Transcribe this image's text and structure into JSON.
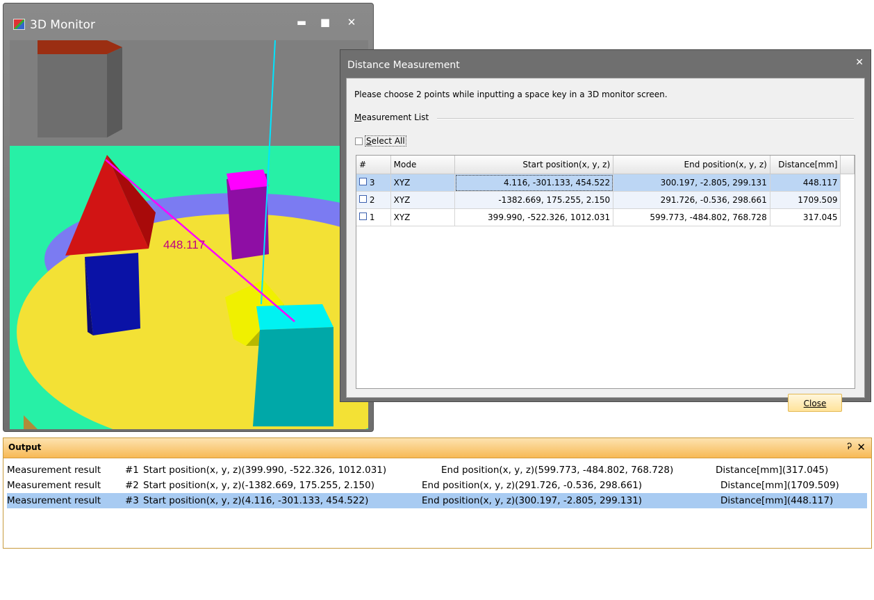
{
  "monitor_window": {
    "title": "3D Monitor",
    "overlay_distance_label": "448.117",
    "controls": {
      "minimize": "▬",
      "maximize": "■",
      "close": "✕"
    }
  },
  "dialog": {
    "title": "Distance Measurement",
    "close_glyph": "✕",
    "instruction": "Please choose 2 points while inputting a space key in a 3D monitor screen.",
    "group_label_underlined": "M",
    "group_label_rest": "easurement List",
    "select_all_label_underlined": "S",
    "select_all_label_rest": "elect All",
    "columns": [
      "#",
      "Mode",
      "Start position(x, y, z)",
      "End position(x, y, z)",
      "Distance[mm]"
    ],
    "rows": [
      {
        "num": "3",
        "mode": "XYZ",
        "start": "4.116, -301.133, 454.522",
        "end": "300.197, -2.805, 299.131",
        "distance": "448.117"
      },
      {
        "num": "2",
        "mode": "XYZ",
        "start": "-1382.669, 175.255, 2.150",
        "end": "291.726, -0.536, 298.661",
        "distance": "1709.509"
      },
      {
        "num": "1",
        "mode": "XYZ",
        "start": "399.990, -522.326, 1012.031",
        "end": "599.773, -484.802, 768.728",
        "distance": "317.045"
      }
    ],
    "close_button": "Close"
  },
  "output": {
    "title": "Output",
    "pin_glyph": "Ꭾ",
    "close_glyph": "✕",
    "lines": [
      {
        "label": "Measurement result",
        "idx": "#1",
        "start": "Start position(x, y, z)(399.990, -522.326, 1012.031)",
        "end": "End position(x, y, z)(599.773, -484.802, 768.728)",
        "dist": "Distance[mm](317.045)"
      },
      {
        "label": "Measurement result",
        "idx": "#2",
        "start": "Start position(x, y, z)(-1382.669, 175.255, 2.150)",
        "end": "End position(x, y, z)(291.726, -0.536, 298.661)",
        "dist": "Distance[mm](1709.509)"
      },
      {
        "label": "Measurement result",
        "idx": "#3",
        "start": "Start position(x, y, z)(4.116, -301.133, 454.522)",
        "end": "End position(x, y, z)(300.197, -2.805, 299.131)",
        "dist": "Distance[mm](448.117)"
      }
    ]
  },
  "colors": {
    "selection": "#bcd6f4",
    "output_header": "#f7b955",
    "measure_line": "#e000e0"
  }
}
